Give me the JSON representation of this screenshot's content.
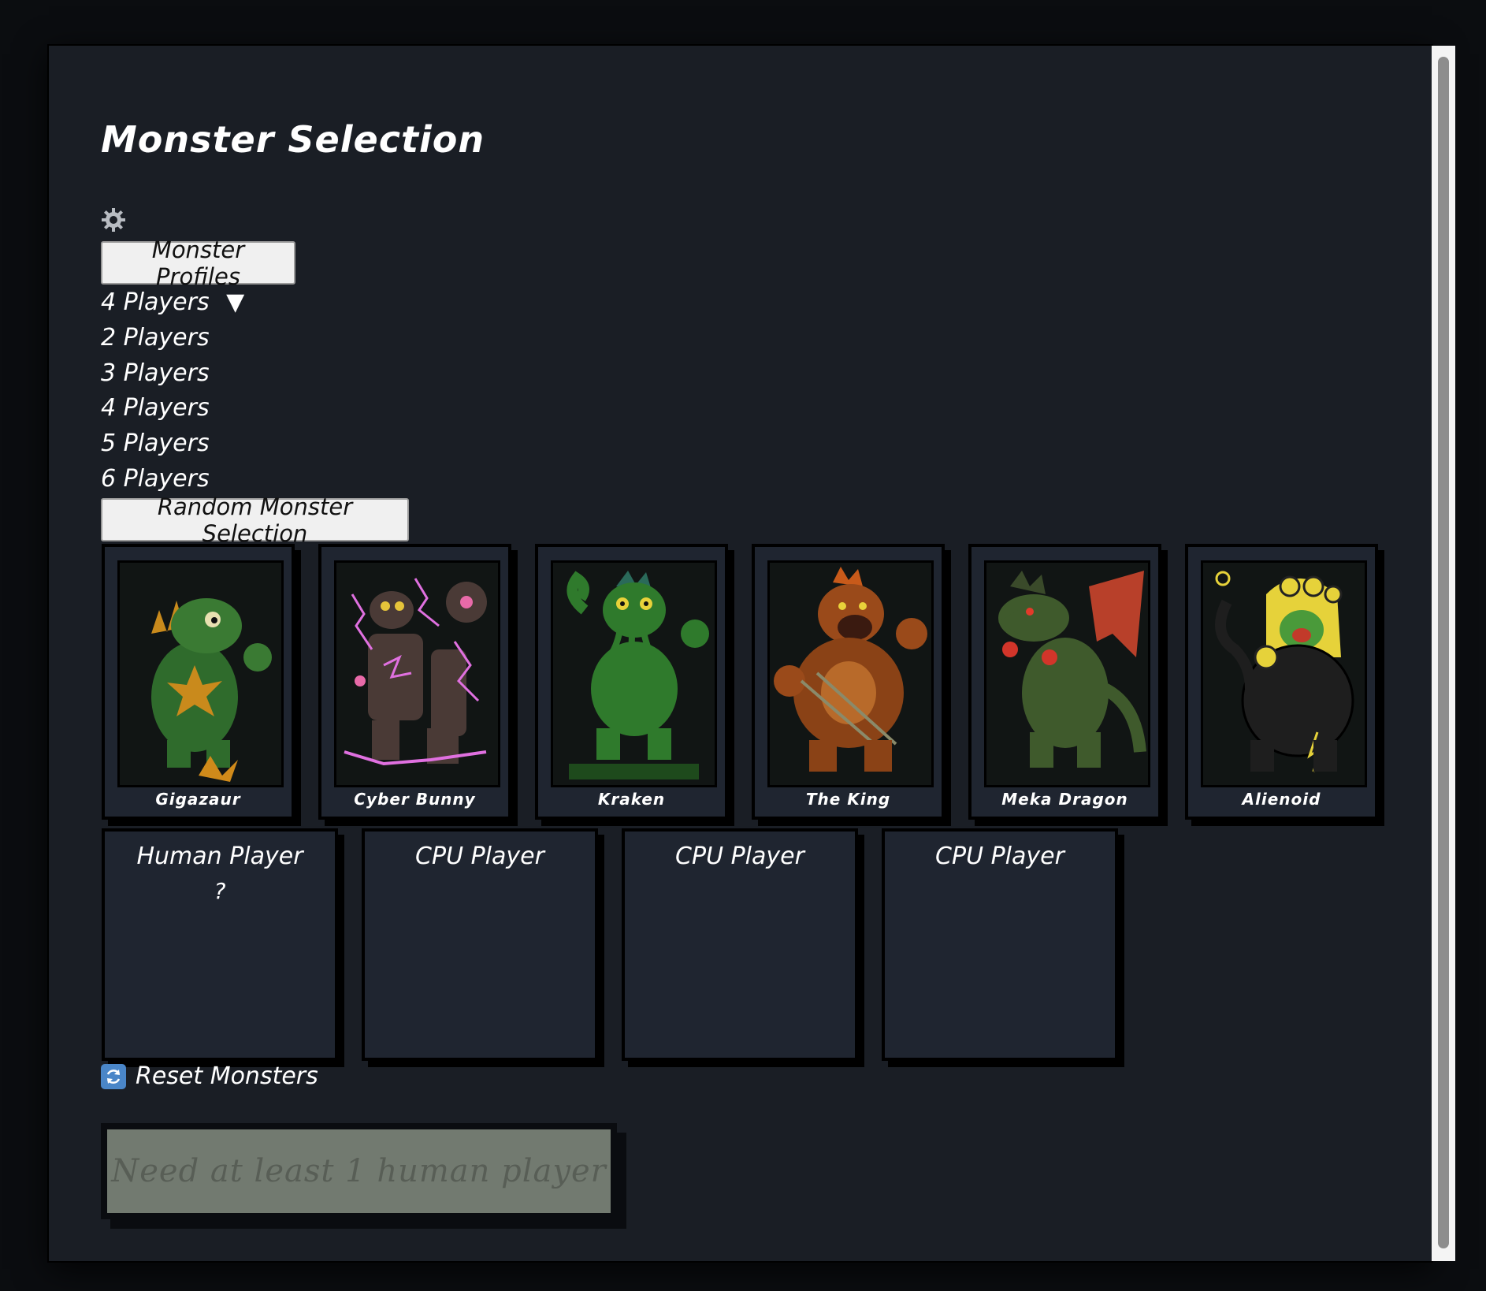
{
  "title": "Monster Selection",
  "toolbar": {
    "settings_icon": "gear-icon",
    "profiles_label": "Monster Profiles"
  },
  "players": {
    "selected": "4 Players",
    "arrow": "▼",
    "options": [
      "2 Players",
      "3 Players",
      "4 Players",
      "5 Players",
      "6 Players"
    ]
  },
  "random_label": "Random Monster Selection",
  "monsters": [
    {
      "name": "Gigazaur"
    },
    {
      "name": "Cyber Bunny"
    },
    {
      "name": "Kraken"
    },
    {
      "name": "The King"
    },
    {
      "name": "Meka Dragon"
    },
    {
      "name": "Alienoid"
    }
  ],
  "slots": [
    {
      "label": "Human Player",
      "monster": "?"
    },
    {
      "label": "CPU Player",
      "monster": ""
    },
    {
      "label": "CPU Player",
      "monster": ""
    },
    {
      "label": "CPU Player",
      "monster": ""
    }
  ],
  "reset_label": "Reset Monsters",
  "reset_icon": "refresh-icon",
  "start_label": "Need at least 1 human player",
  "colors": {
    "background": "#1a1e25",
    "card": "#1f2530",
    "start_disabled": "#727a70"
  }
}
